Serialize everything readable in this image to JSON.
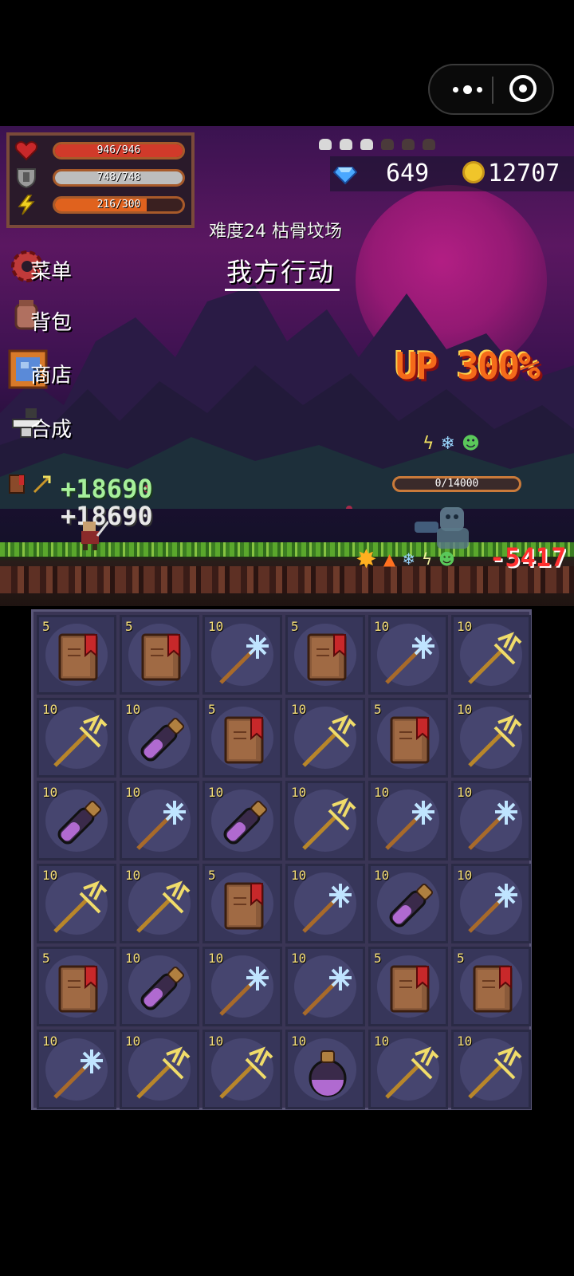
{
  "stats": {
    "hp": {
      "label": "946/946",
      "current": 946,
      "max": 946,
      "color": "#d13a2a"
    },
    "armor": {
      "label": "748/748",
      "current": 748,
      "max": 748,
      "color": "#bdbdbd"
    },
    "energy": {
      "label": "216/300",
      "current": 216,
      "max": 300,
      "color": "#e0621e"
    }
  },
  "currency": {
    "gems": "649",
    "gold": "12707"
  },
  "location": "难度24 枯骨坟场",
  "turn_label": "我方行动",
  "menu": [
    {
      "label": "菜单",
      "icon": "gear-icon"
    },
    {
      "label": "背包",
      "icon": "bag-icon"
    },
    {
      "label": "商店",
      "icon": "shop-icon"
    },
    {
      "label": "合成",
      "icon": "anvil-icon"
    }
  ],
  "boost_text": "UP 300%",
  "enemy": {
    "hp_label": "0/14000",
    "current": 0,
    "max": 14000,
    "buffs": [
      "lightning-icon",
      "frost-icon",
      "poison-icon"
    ]
  },
  "combat_text": {
    "heal_1": "+18690",
    "heal_2": "+18690",
    "damage": "-5417"
  },
  "inventory": [
    [
      {
        "item": "book",
        "qty": "5"
      },
      {
        "item": "frost-staff",
        "qty": "10"
      },
      {
        "item": "trident",
        "qty": "10"
      }
    ],
    [],
    [],
    [],
    [],
    []
  ],
  "inventory_grid": [
    [
      "book:5",
      "book:5",
      "frost-staff:10",
      "book:5",
      "frost-staff:10",
      "trident:10"
    ],
    [
      "trident:10",
      "potion:10",
      "book:5",
      "trident:10",
      "book:5",
      "trident:10"
    ],
    [
      "potion:10",
      "frost-staff:10",
      "potion:10",
      "trident:10",
      "frost-staff:10",
      "frost-staff:10"
    ],
    [
      "trident:10",
      "trident:10",
      "book:5",
      "frost-staff:10",
      "potion:10",
      "frost-staff:10"
    ],
    [
      "book:5",
      "potion:10",
      "frost-staff:10",
      "frost-staff:10",
      "book:5",
      "book:5"
    ],
    [
      "frost-staff:10",
      "trident:10",
      "trident:10",
      "round-potion:10",
      "trident:10",
      "trident:10"
    ]
  ]
}
